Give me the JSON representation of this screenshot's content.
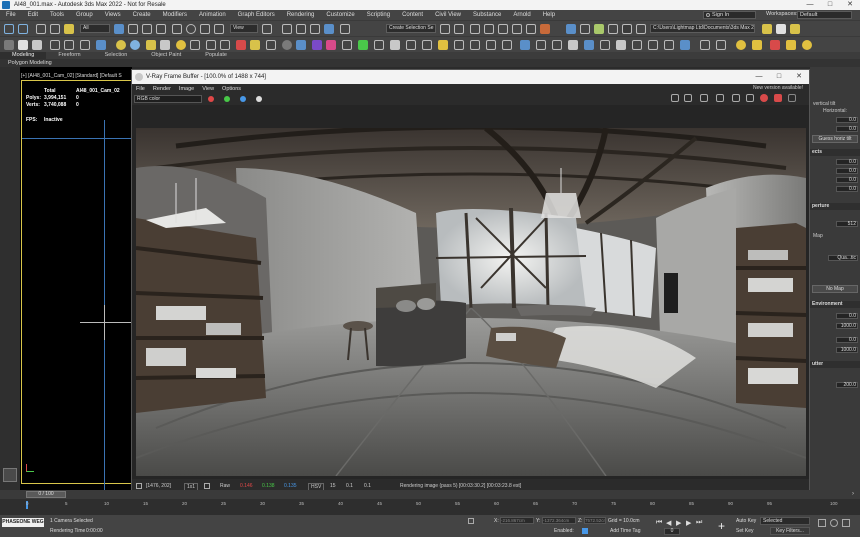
{
  "window": {
    "title": "AI48_001.max - Autodesk 3ds Max 2022 - Not for Resale",
    "min": "—",
    "max": "□",
    "close": "✕"
  },
  "menu": {
    "items": [
      "File",
      "Edit",
      "Tools",
      "Group",
      "Views",
      "Create",
      "Modifiers",
      "Animation",
      "Graph Editors",
      "Rendering",
      "Customize",
      "Scripting",
      "Content",
      "Civil View",
      "Substance",
      "Arnold",
      "Help"
    ],
    "sign_in": "Sign In",
    "workspaces_label": "Workspaces:",
    "workspace_value": "Default"
  },
  "toolbar": {
    "selection_filter": "All",
    "ref_coord": "View",
    "selection_set": "Create Selection Se",
    "project_path": "C:\\Users\\Lightmap Ltd\\Documents\\3ds Max 2022"
  },
  "ribbon": {
    "tabs": [
      "Modeling",
      "Freeform",
      "Selection",
      "Object Paint",
      "Populate"
    ],
    "active_tab": "Modeling",
    "sub_label": "Polygon Modeling"
  },
  "viewport": {
    "label": "[+] [AI48_001_Cam_02] [Standard] [Default S",
    "stats_total_label": "Total",
    "stats_obj_label": "AI48_001_Cam_02",
    "polys_label": "Polys:",
    "polys_total": "3,994,151",
    "polys_obj": "0",
    "verts_label": "Verts:",
    "verts_total": "3,740,088",
    "verts_obj": "0",
    "fps_label": "FPS:",
    "fps_value": "Inactive"
  },
  "vfb": {
    "title": "V-Ray Frame Buffer - [100.0% of 1488 x 744]",
    "menu": [
      "File",
      "Render",
      "Image",
      "View",
      "Options"
    ],
    "new_version": "New version available!",
    "channel": "RGB color",
    "status": {
      "coords": "[1476, 202]",
      "zoom": "1x1",
      "mode": "Raw",
      "r": "0.146",
      "g": "0.138",
      "b": "0.135",
      "color_mode": "HSV",
      "v1": "15",
      "v2": "0.1",
      "v3": "0.1",
      "message": "Rendering image (pass 5) [00:03:30.2] [00:03:23.8 est]"
    },
    "colors": {
      "red": "#e04848",
      "green": "#48c848",
      "blue": "#4898e8"
    }
  },
  "command_panel": {
    "vertical_tilt": "vertical tilt",
    "horizontal": "Horizontal:",
    "v1": "0.0",
    "v2": "0.0",
    "guess": "Guess horiz tilt",
    "effects": "ects",
    "v3": "0.0",
    "v4": "0.0",
    "v5": "0.0",
    "v6": "0.0",
    "perture": "perture",
    "val512": "512",
    "map_label": "Map",
    "qua": "Qua...tic",
    "nomap": "No Map",
    "environment": "Environment",
    "e1": "0.0",
    "e2": "1000.0",
    "e3": "0.0",
    "e4": "1000.0",
    "shutter": "utter",
    "s1": "200.0"
  },
  "timeline": {
    "frame": "0 / 100",
    "ticks": [
      "0",
      "5",
      "10",
      "15",
      "20",
      "25",
      "30",
      "35",
      "40",
      "45",
      "50",
      "55",
      "60",
      "65",
      "70",
      "75",
      "80",
      "85",
      "90",
      "95",
      "100"
    ]
  },
  "bottom": {
    "logo_text": "PHASEONE WEG",
    "selected": "1 Camera Selected",
    "render_time_label": "Rendering Time",
    "render_time": "0:00:00",
    "x_label": "X:",
    "x_val": "-216.867cm",
    "y_label": "Y:",
    "y_val": "-1372.364cm",
    "z_label": "Z:",
    "z_val": "7572.52cm",
    "enabled_label": "Enabled:",
    "grid": "Grid = 10.0cm",
    "add_time_tag": "Add Time Tag",
    "auto_key": "Auto Key",
    "set_key": "Set Key",
    "selected_dd": "Selected",
    "key_filters": "Key Filters...",
    "frame_val": "0"
  }
}
